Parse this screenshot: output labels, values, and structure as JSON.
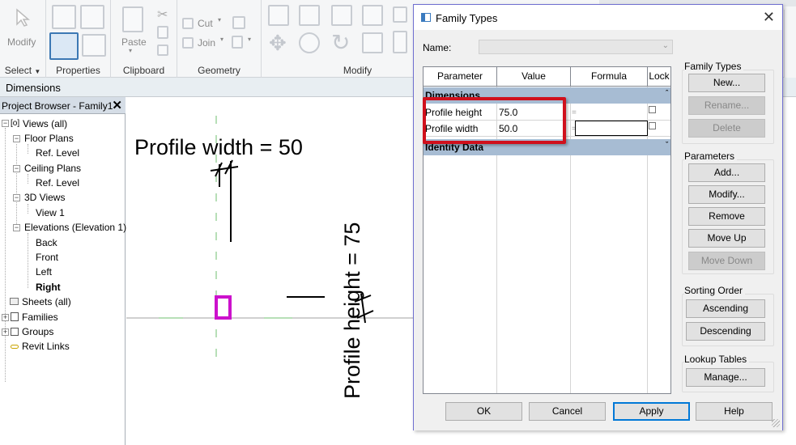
{
  "ribbon": {
    "groups": [
      {
        "label": "Select",
        "arrow": "▼"
      },
      {
        "label": "Properties"
      },
      {
        "label": "Clipboard"
      },
      {
        "label": "Geometry"
      },
      {
        "label": "Modify"
      }
    ],
    "buttons": {
      "modify": "Modify",
      "paste": "Paste",
      "cut": "Cut",
      "join": "Join"
    }
  },
  "dimensions_bar": {
    "label": "Dimensions"
  },
  "project_browser": {
    "title": "Project Browser - Family1",
    "close": "✕",
    "items": [
      {
        "label": "Views (all)",
        "expander": "−"
      },
      {
        "label": "Floor Plans",
        "expander": "−"
      },
      {
        "label": "Ref. Level"
      },
      {
        "label": "Ceiling Plans",
        "expander": "−"
      },
      {
        "label": "Ref. Level"
      },
      {
        "label": "3D Views",
        "expander": "−"
      },
      {
        "label": "View 1"
      },
      {
        "label": "Elevations (Elevation 1)",
        "expander": "−"
      },
      {
        "label": "Back"
      },
      {
        "label": "Front"
      },
      {
        "label": "Left"
      },
      {
        "label": "Right"
      },
      {
        "label": "Sheets (all)"
      },
      {
        "label": "Families",
        "expander": "+"
      },
      {
        "label": "Groups",
        "expander": "+"
      },
      {
        "label": "Revit Links"
      }
    ]
  },
  "canvas": {
    "width_label": "Profile width = 50",
    "height_label": "Profile height = 75"
  },
  "dialog": {
    "title": "Family Types",
    "close": "✕",
    "name_label": "Name:",
    "name_value": "",
    "grid": {
      "headers": [
        "Parameter",
        "Value",
        "Formula",
        "Lock"
      ],
      "sections": [
        {
          "label": "Dimensions",
          "caret": "ˆ"
        },
        {
          "label": "Identity Data",
          "caret": "ˇ"
        }
      ],
      "rows": [
        {
          "parameter": "Profile height",
          "value": "75.0",
          "formula": "",
          "equals": "="
        },
        {
          "parameter": "Profile width",
          "value": "50.0",
          "formula": "",
          "equals": "="
        }
      ]
    },
    "family_types": {
      "title": "Family Types",
      "new": "New...",
      "rename": "Rename...",
      "delete": "Delete"
    },
    "parameters": {
      "title": "Parameters",
      "add": "Add...",
      "modify": "Modify...",
      "remove": "Remove",
      "move_up": "Move Up",
      "move_down": "Move Down"
    },
    "sorting": {
      "title": "Sorting Order",
      "ascending": "Ascending",
      "descending": "Descending"
    },
    "lookup": {
      "title": "Lookup Tables",
      "manage": "Manage..."
    },
    "footer": {
      "ok": "OK",
      "cancel": "Cancel",
      "apply": "Apply",
      "help": "Help"
    }
  },
  "colors": {
    "highlight": "#d0101c",
    "section_header": "#a7bcd3",
    "profile_rect": "#cc11cc",
    "ref_plane": "#6fbf6f"
  }
}
